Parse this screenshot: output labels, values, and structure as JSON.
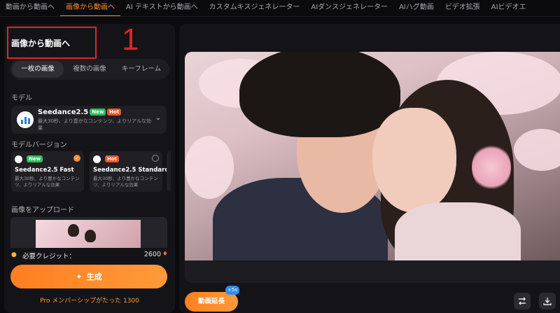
{
  "nav": {
    "tabs": [
      {
        "label": "動画から動画へ"
      },
      {
        "label": "画像から動画へ"
      },
      {
        "label": "AI テキストから動画へ"
      },
      {
        "label": "カスタムキスジェネレーター"
      },
      {
        "label": "AIダンスジェネレーター"
      },
      {
        "label": "AIハグ動画"
      },
      {
        "label": "ビデオ拡張"
      },
      {
        "label": "AIビデオエ"
      }
    ],
    "active_index": 1
  },
  "left": {
    "title": "画像から動画へ",
    "annotation_number": "1",
    "modes": [
      "一枚の画像",
      "複数の画像",
      "キーフレーム"
    ],
    "model_section_label": "モデル",
    "model": {
      "name": "Seedance2.5",
      "badge_new": "New",
      "badge_hot": "Hot",
      "description": "最大30秒、より豊かなコンテンツ、よりリアルな効果"
    },
    "version_section_label": "モデルバージョン",
    "versions": [
      {
        "badge": "New",
        "name": "Seedance2.5 Fast",
        "description": "最大30秒、より豊かなコンテンツ、よりリアルな効果",
        "selected": true
      },
      {
        "badge": "Hot",
        "name": "Seedance2.5 Standard",
        "description": "最大30秒、より豊かなコンテンツ、よりリアルな効果",
        "selected": false
      }
    ],
    "upload_label": "画像をアップロード",
    "credit_label": "必要クレジット：",
    "credit_value": "2600",
    "generate_label": "生成",
    "pro_text": "Pro メンバーシップがたった 1300"
  },
  "right": {
    "extend_label": "動画延長",
    "extend_badge": "+5s"
  },
  "colors": {
    "accent": "#ff8a2a",
    "annotation": "#e0242b",
    "badge_new": "#2fbf5a",
    "badge_hot": "#f0552a"
  }
}
